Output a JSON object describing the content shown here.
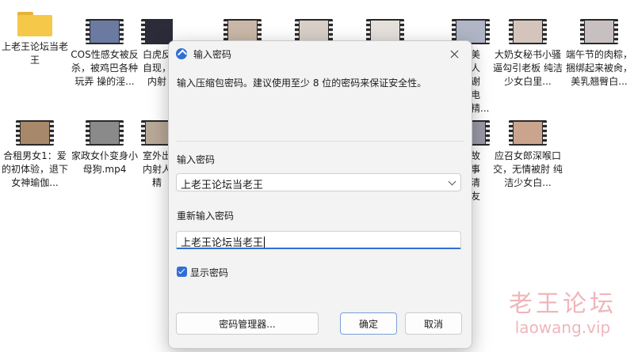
{
  "desktop": {
    "files": [
      {
        "label": "上老王论坛当老王",
        "kind": "folder",
        "color": "#f6c84a"
      },
      {
        "label": "COS性感女被反杀，被鸡巴各种玩弄 操的淫...",
        "kind": "video",
        "color": "#6b7aa0"
      },
      {
        "label": "白虎反自现，内射",
        "kind": "video",
        "color": "#2b2b3a"
      },
      {
        "label": "",
        "kind": "video",
        "color": "#c9b8a8"
      },
      {
        "label": "",
        "kind": "video",
        "color": "#d8d0c8"
      },
      {
        "label": "",
        "kind": "video",
        "color": "#e6e0dc"
      },
      {
        "label": "美人谢电精...",
        "kind": "video",
        "color": "#b0b6c6"
      },
      {
        "label": "大奶女秘书小骚逼勾引老板 纯洁少女白里...",
        "kind": "video",
        "color": "#d4c4bc"
      },
      {
        "label": "端午节的肉粽，捆绑起来被肏，美乳翘臀白...",
        "kind": "video",
        "color": "#c8c0c0"
      },
      {
        "label": "合租男女1：爱的初体验，退下女神瑜伽...",
        "kind": "video",
        "color": "#a8886a"
      },
      {
        "label": "家政女仆变身小母狗.mp4",
        "kind": "video",
        "color": "#8a8a8a"
      },
      {
        "label": "室外出内射人精",
        "kind": "video",
        "color": "#b8a898"
      },
      {
        "label": "故事清友",
        "kind": "video",
        "color": "#9a9aa8"
      },
      {
        "label": "应召女郎深喉口交，无情被肘 纯洁少女白...",
        "kind": "video",
        "color": "#caa48c"
      }
    ]
  },
  "dialog": {
    "title": "输入密码",
    "description": "输入压缩包密码。建议使用至少 8 位的密码来保证安全性。",
    "password_label": "输入密码",
    "password_value": "上老王论坛当老王",
    "confirm_label": "重新输入密码",
    "confirm_value": "上老王论坛当老王",
    "show_password_label": "显示密码",
    "show_password_checked": true,
    "manager_button": "密码管理器...",
    "ok_button": "确定",
    "cancel_button": "取消",
    "accent_color": "#2f6fd6"
  },
  "watermark": {
    "line1": "老王论坛",
    "line2": "laowang.vip"
  }
}
